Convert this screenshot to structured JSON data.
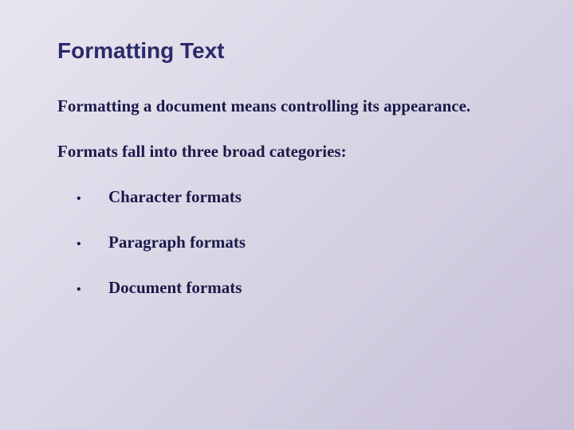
{
  "title": "Formatting Text",
  "intro": "Formatting a document means controlling its appearance.",
  "subintro": "Formats fall into three broad categories:",
  "bullets": {
    "b0": "Character formats",
    "b1": "Paragraph formats",
    "b2": "Document formats"
  }
}
